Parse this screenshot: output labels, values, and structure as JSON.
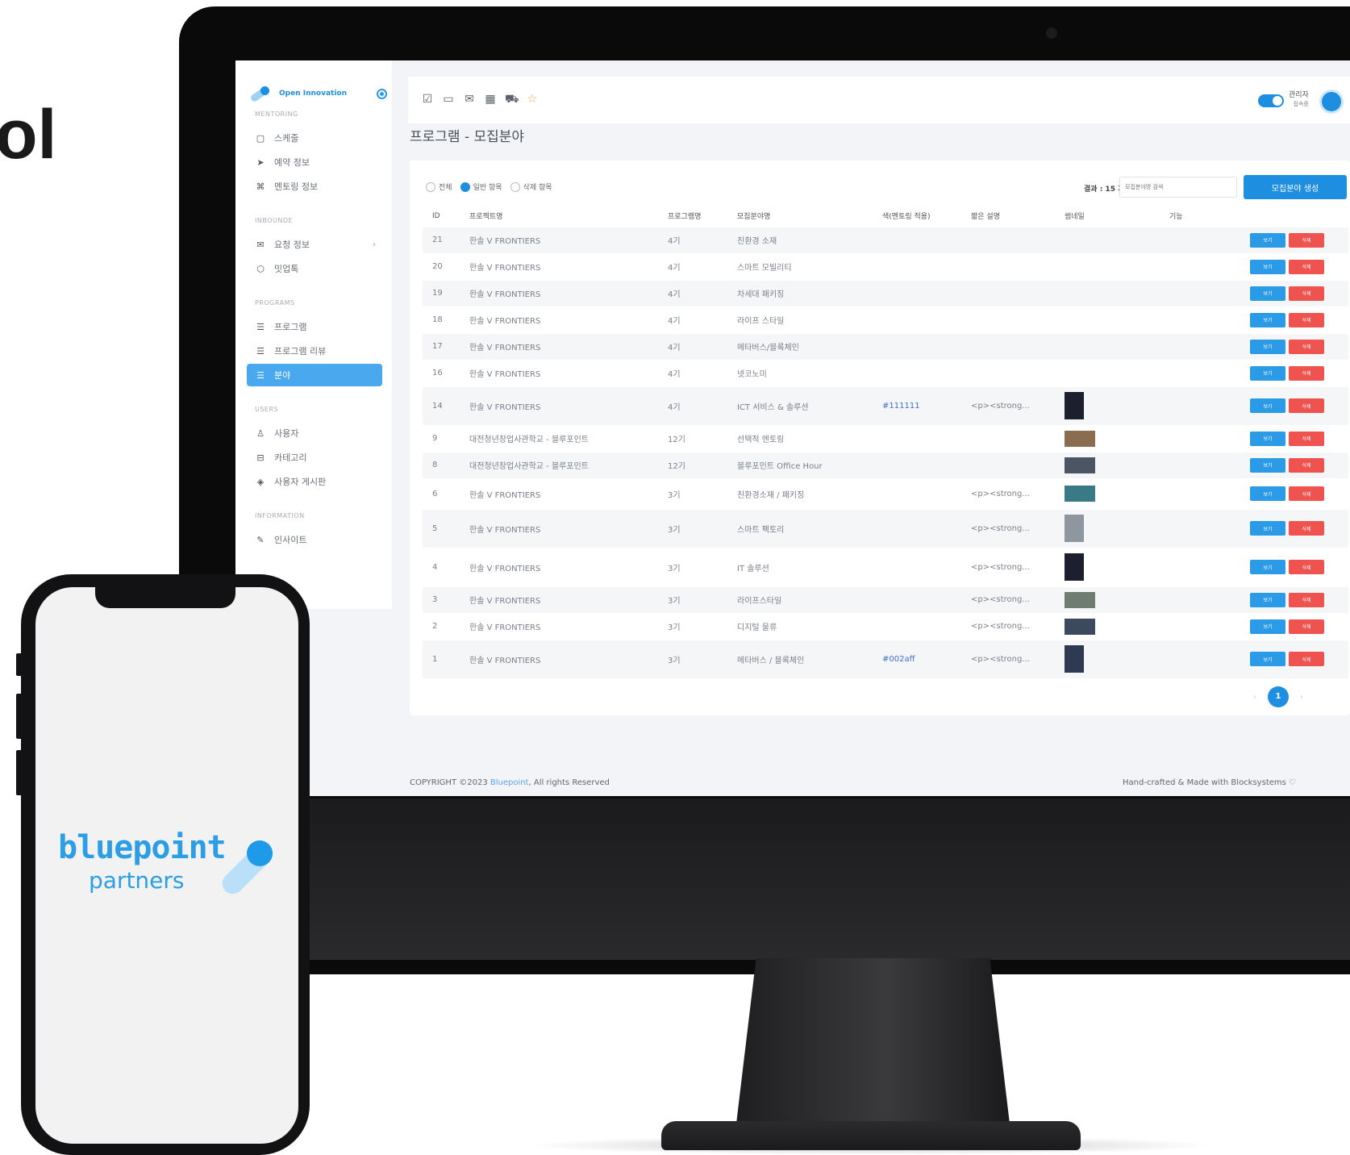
{
  "fragment_heading": "ol",
  "sidebar": {
    "logo_text": "Open Innovation",
    "sections": [
      {
        "label": "MENTORING",
        "items": [
          {
            "icon": "calendar-icon",
            "glyph": "▢",
            "label": "스케줄"
          },
          {
            "icon": "send-icon",
            "glyph": "➤",
            "label": "예약 정보"
          },
          {
            "icon": "command-icon",
            "glyph": "⌘",
            "label": "멘토링 정보"
          }
        ]
      },
      {
        "label": "INBOUNDE",
        "items": [
          {
            "icon": "mail-icon",
            "glyph": "✉",
            "label": "요청 정보",
            "chevron": "›"
          },
          {
            "icon": "box-icon",
            "glyph": "⬡",
            "label": "밋업톡"
          }
        ]
      },
      {
        "label": "PROGRAMS",
        "items": [
          {
            "icon": "list-icon",
            "glyph": "☰",
            "label": "프로그램"
          },
          {
            "icon": "list-icon",
            "glyph": "☰",
            "label": "프로그램 리뷰"
          },
          {
            "icon": "list-icon",
            "glyph": "☰",
            "label": "분야",
            "active": true
          }
        ]
      },
      {
        "label": "USERS",
        "items": [
          {
            "icon": "user-icon",
            "glyph": "♙",
            "label": "사용자"
          },
          {
            "icon": "inbox-icon",
            "glyph": "⊟",
            "label": "카테고리"
          },
          {
            "icon": "layers-icon",
            "glyph": "◈",
            "label": "사용자 게시판"
          }
        ]
      },
      {
        "label": "INFORMATION",
        "items": [
          {
            "icon": "edit-icon",
            "glyph": "✎",
            "label": "인사이트"
          }
        ]
      }
    ]
  },
  "topbar": {
    "icons": [
      "check-square-icon",
      "message-icon",
      "mail-icon",
      "calendar-icon",
      "cart-icon",
      "star-icon"
    ],
    "glyphs": [
      "☑",
      "▭",
      "✉",
      "▦",
      "⛟",
      "☆"
    ],
    "admin_label": "관리자",
    "admin_sub": "접속중"
  },
  "page_title": "프로그램 - 모집분야",
  "filters": {
    "all": "전체",
    "normal": "일반 항목",
    "deleted": "삭제 항목"
  },
  "result_count": "결과 : 15 개",
  "search_placeholder": "모집분야명 검색",
  "create_button": "모집분야 생성",
  "table": {
    "headers": [
      "ID",
      "프로젝트명",
      "프로그램명",
      "모집분야명",
      "색(멘토링 적용)",
      "짧은 설명",
      "썸네일",
      "기능"
    ],
    "view_label": "보기",
    "delete_label": "삭제",
    "rows": [
      {
        "id": "21",
        "project": "한솔 V FRONTIERS",
        "program": "4기",
        "field": "친환경 소재",
        "color": "",
        "desc": "",
        "thumb": ""
      },
      {
        "id": "20",
        "project": "한솔 V FRONTIERS",
        "program": "4기",
        "field": "스마트 모빌리티",
        "color": "",
        "desc": "",
        "thumb": ""
      },
      {
        "id": "19",
        "project": "한솔 V FRONTIERS",
        "program": "4기",
        "field": "차세대 패키징",
        "color": "",
        "desc": "",
        "thumb": ""
      },
      {
        "id": "18",
        "project": "한솔 V FRONTIERS",
        "program": "4기",
        "field": "라이프 스타일",
        "color": "",
        "desc": "",
        "thumb": ""
      },
      {
        "id": "17",
        "project": "한솔 V FRONTIERS",
        "program": "4기",
        "field": "메타버스/블록체인",
        "color": "",
        "desc": "",
        "thumb": ""
      },
      {
        "id": "16",
        "project": "한솔 V FRONTIERS",
        "program": "4기",
        "field": "넷코노미",
        "color": "",
        "desc": "",
        "thumb": ""
      },
      {
        "id": "14",
        "project": "한솔 V FRONTIERS",
        "program": "4기",
        "field": "ICT 서비스 & 솔루션",
        "color": "#111111",
        "desc": "<p><strong...",
        "thumb": "#1b1f2e"
      },
      {
        "id": "9",
        "project": "대전청년창업사관학교 - 블루포인트",
        "program": "12기",
        "field": "선택적 멘토링",
        "color": "",
        "desc": "",
        "thumb": "#8a6c4f"
      },
      {
        "id": "8",
        "project": "대전청년창업사관학교 - 블루포인트",
        "program": "12기",
        "field": "블루포인트 Office Hour",
        "color": "",
        "desc": "",
        "thumb": "#4b5563"
      },
      {
        "id": "6",
        "project": "한솔 V FRONTIERS",
        "program": "3기",
        "field": "친환경소재 / 패키징",
        "color": "",
        "desc": "<p><strong...",
        "thumb": "#3a7a86"
      },
      {
        "id": "5",
        "project": "한솔 V FRONTIERS",
        "program": "3기",
        "field": "스마트 팩토리",
        "color": "",
        "desc": "<p><strong...",
        "thumb": "#8e96a0"
      },
      {
        "id": "4",
        "project": "한솔 V FRONTIERS",
        "program": "3기",
        "field": "IT 솔루션",
        "color": "",
        "desc": "<p><strong...",
        "thumb": "#1b1f2e"
      },
      {
        "id": "3",
        "project": "한솔 V FRONTIERS",
        "program": "3기",
        "field": "라이프스타일",
        "color": "",
        "desc": "<p><strong...",
        "thumb": "#6f7d70"
      },
      {
        "id": "2",
        "project": "한솔 V FRONTIERS",
        "program": "3기",
        "field": "디지털 물류",
        "color": "",
        "desc": "<p><strong...",
        "thumb": "#3b4a5c"
      },
      {
        "id": "1",
        "project": "한솔 V FRONTIERS",
        "program": "3기",
        "field": "메타버스 / 블록체인",
        "color": "#002aff",
        "desc": "<p><strong...",
        "thumb": "#2e3a52"
      }
    ]
  },
  "pagination": {
    "prev": "‹",
    "current": "1",
    "next": "›"
  },
  "footer": {
    "copyright_prefix": "COPYRIGHT ©2023 ",
    "brand": "Bluepoint",
    "copyright_suffix": ", All rights Reserved",
    "right": "Hand-crafted & Made with Blocksystems ♡"
  },
  "phone": {
    "logo_word": "bluepoint",
    "logo_sub": "partners"
  },
  "colors": {
    "accent": "#1e8fe0",
    "danger": "#ef5350",
    "active_nav": "#4aa8ee"
  }
}
